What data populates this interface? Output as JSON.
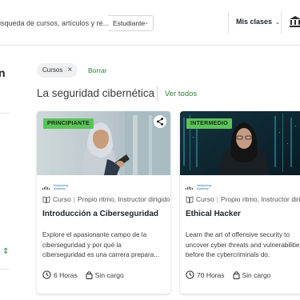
{
  "header": {
    "search_value": "úsqueda de cursos, artículos y re...",
    "audience_select": "Estudiante",
    "my_classes": "Mis clases",
    "icons": [
      "chevron-down-icon",
      "institution-icon"
    ]
  },
  "sidebar": {
    "heading_fragment": "n"
  },
  "filters": {
    "chip_label": "Cursos",
    "clear_label": "Borrar"
  },
  "section": {
    "title": "La seguridad cibernética",
    "see_all": "Ver todos"
  },
  "cards": [
    {
      "level": "PRINCIPIANTE",
      "logo_line1": "Networking",
      "logo_line2": "Academy",
      "logo_brand": "cisco",
      "type": "Curso",
      "pace": "Propio ritmo, Instructor dirigido",
      "title": "Introducción a Ciberseguridad",
      "description": "Explore el apasionante campo de la ciberseguridad y por qué la ciberseguridad es una carrera prepara...",
      "hours": "6 Horas",
      "cost": "Sin cargo",
      "badge_color": "#5cc35b"
    },
    {
      "level": "INTERMEDIO",
      "logo_line1": "Networking",
      "logo_line2": "Academy",
      "logo_brand": "cisco",
      "type": "Curso",
      "pace": "Propio ritmo, Instructor dirigido",
      "title": "Ethical Hacker",
      "description": "Learn the art of offensive security to uncover cyber threats and vulnerabilities before the cybercriminals do.",
      "hours": "70 Horas",
      "cost": "Sin cargo",
      "badge_color": "#5cc35b"
    }
  ],
  "colors": {
    "accent": "#2e7d32",
    "badge": "#5cc35b"
  }
}
